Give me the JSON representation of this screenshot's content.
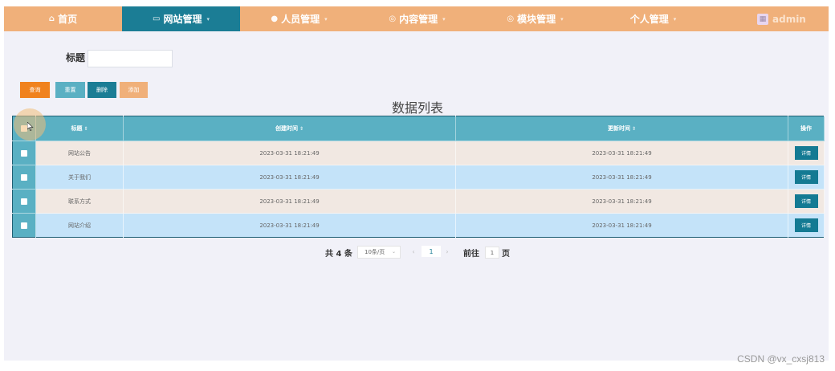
{
  "nav": {
    "items": [
      {
        "label": "首页",
        "icon": "home-icon",
        "glyph": "⌂",
        "active": false
      },
      {
        "label": "网站管理",
        "icon": "monitor-icon",
        "glyph": "▭",
        "active": true
      },
      {
        "label": "人员管理",
        "icon": "user-icon",
        "glyph": "●",
        "active": false
      },
      {
        "label": "内容管理",
        "icon": "content-icon",
        "glyph": "◎",
        "active": false
      },
      {
        "label": "模块管理",
        "icon": "module-icon",
        "glyph": "◎",
        "active": false
      },
      {
        "label": "个人管理",
        "icon": "",
        "glyph": "",
        "active": false
      }
    ],
    "caret": "▾",
    "user": {
      "name": "admin",
      "avatar_icon": "avatar-image-icon"
    }
  },
  "search": {
    "label": "标题",
    "value": ""
  },
  "buttons": {
    "query": {
      "label": "查询",
      "color": "#f0821e"
    },
    "reset": {
      "label": "重置",
      "color": "#5ab0c3"
    },
    "delete": {
      "label": "删除",
      "color": "#1b7d95"
    },
    "add": {
      "label": "添加",
      "color": "#f0b07a"
    }
  },
  "list_title": "数据列表",
  "table": {
    "columns": {
      "title": "标题",
      "created": "创建时间",
      "updated": "更新时间",
      "action": "操作"
    },
    "sort_icon": "⇕",
    "rows": [
      {
        "title": "网站公告",
        "created": "2023-03-31 18:21:49",
        "updated": "2023-03-31 18:21:49",
        "action": "详情"
      },
      {
        "title": "关于我们",
        "created": "2023-03-31 18:21:49",
        "updated": "2023-03-31 18:21:49",
        "action": "详情"
      },
      {
        "title": "联系方式",
        "created": "2023-03-31 18:21:49",
        "updated": "2023-03-31 18:21:49",
        "action": "详情"
      },
      {
        "title": "网站介绍",
        "created": "2023-03-31 18:21:49",
        "updated": "2023-03-31 18:21:49",
        "action": "详情"
      }
    ],
    "header_bg": "#5ab0c3",
    "row_colors": [
      "#f1e8e2",
      "#c4e3f9"
    ]
  },
  "pagination": {
    "total": "共 4 条",
    "page_size": "10条/页",
    "page_size_caret": "⌄",
    "prev": "‹",
    "current": "1",
    "next": "›",
    "goto_label": "前往",
    "goto_value": "1",
    "goto_suffix": "页"
  },
  "watermark": "CSDN @vx_cxsj813"
}
